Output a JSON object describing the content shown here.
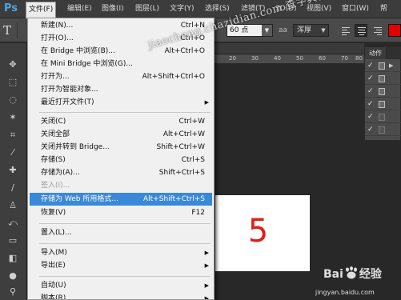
{
  "app": {
    "logo": "Ps"
  },
  "menubar": {
    "items": [
      {
        "label": "文件(F)",
        "active": true
      },
      {
        "label": "编辑(E)"
      },
      {
        "label": "图像(I)"
      },
      {
        "label": "图层(L)"
      },
      {
        "label": "文字(Y)"
      },
      {
        "label": "选择(S)"
      },
      {
        "label": "滤镜(T)"
      },
      {
        "label": "3D(D)"
      },
      {
        "label": "视图(V)"
      },
      {
        "label": "窗口(W)"
      },
      {
        "label": "帮"
      }
    ]
  },
  "options_bar": {
    "tool_icon": "T",
    "font_size": "60 点",
    "antialias_icon": "aa",
    "antialias_value": "浑厚",
    "text_color": "#e30000"
  },
  "ruler": {
    "labels": [
      "20",
      "30",
      "40",
      "50",
      "60",
      "70",
      "80"
    ]
  },
  "document": {
    "text": "5",
    "text_color": "#e21e16"
  },
  "actions_panel": {
    "tab_label": "动作"
  },
  "file_menu": {
    "items": [
      {
        "label": "新建(N)...",
        "shortcut": "Ctrl+N"
      },
      {
        "label": "打开(O)...",
        "shortcut": "Ctrl+O"
      },
      {
        "label": "在 Bridge 中浏览(B)...",
        "shortcut": "Alt+Ctrl+O"
      },
      {
        "label": "在 Mini Bridge 中浏览(G)...",
        "shortcut": ""
      },
      {
        "label": "打开为...",
        "shortcut": "Alt+Shift+Ctrl+O"
      },
      {
        "label": "打开为智能对象...",
        "shortcut": ""
      },
      {
        "label": "最近打开文件(T)",
        "shortcut": "",
        "submenu": true
      },
      {
        "label": "关闭(C)",
        "shortcut": "Ctrl+W"
      },
      {
        "label": "关闭全部",
        "shortcut": "Alt+Ctrl+W"
      },
      {
        "label": "关闭并转到 Bridge...",
        "shortcut": "Shift+Ctrl+W"
      },
      {
        "label": "存储(S)",
        "shortcut": "Ctrl+S"
      },
      {
        "label": "存储为(A)...",
        "shortcut": "Shift+Ctrl+S"
      },
      {
        "label": "签入(I)...",
        "shortcut": "",
        "disabled": true
      },
      {
        "label": "存储为 Web 所用格式...",
        "shortcut": "Alt+Shift+Ctrl+S",
        "highlighted": true
      },
      {
        "label": "恢复(V)",
        "shortcut": "F12"
      },
      {
        "label": "置入(L)...",
        "shortcut": ""
      },
      {
        "label": "导入(M)",
        "shortcut": "",
        "submenu": true
      },
      {
        "label": "导出(E)",
        "shortcut": "",
        "submenu": true
      },
      {
        "label": "自动(U)",
        "shortcut": "",
        "submenu": true
      },
      {
        "label": "脚本(R)",
        "shortcut": "",
        "submenu": true
      }
    ]
  },
  "watermark": {
    "top": "jiaocheng.chazidian.com 查字典教程网",
    "brand_left": "Bai",
    "brand_right": "经验",
    "url": "jingyan.baidu.com"
  }
}
